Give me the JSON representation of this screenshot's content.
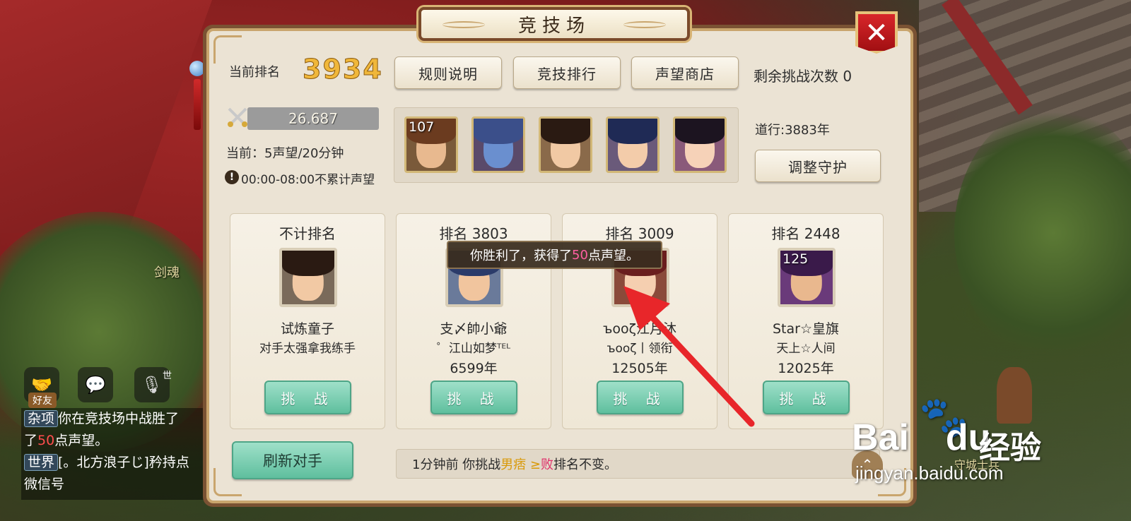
{
  "background": {
    "labels": {
      "sword_soul": "剑魂",
      "guard": "守城士兵"
    },
    "side_buttons": {
      "friends_label": "好友",
      "voice_tag": "世"
    },
    "chat": {
      "line1_tag": "杂项",
      "line1_text": "你在竞技场中战胜了",
      "line2_prefix": "了",
      "line2_highlight": "50",
      "line2_suffix": "点声望。",
      "line3_tag": "世界",
      "line3_text": "[。北方浪子じ]矜持点",
      "line4_text": "微信号"
    }
  },
  "panel": {
    "title": "竞技场",
    "close_label": "✕",
    "current_rank_label": "当前排名",
    "current_rank_value": "3934",
    "buttons": {
      "rules": "规则说明",
      "leaderboard": "竞技排行",
      "shop": "声望商店",
      "adjust_guard": "调整守护",
      "refresh": "刷新对手"
    },
    "remaining_challenges": "剩余挑战次数 0",
    "reputation_value": "26.687",
    "reputation_fill": 0.0,
    "rate_text": "当前：5声望/20分钟",
    "warning_text": "00:00-08:00不累计声望",
    "cultivation_text": "道行:3883年",
    "guards": [
      {
        "level": "107",
        "skin": "#e8b98f",
        "hair": "#6b3b1f",
        "bg": "#7a5a3a"
      },
      {
        "level": "",
        "skin": "#6a8fcf",
        "hair": "#3b4f8a",
        "bg": "#5a4a6a"
      },
      {
        "level": "",
        "skin": "#f1c9a4",
        "hair": "#2a1a12",
        "bg": "#8a6a4a"
      },
      {
        "level": "",
        "skin": "#f3ccaa",
        "hair": "#1f2a55",
        "bg": "#6a5a7a"
      },
      {
        "level": "",
        "skin": "#f6d2b8",
        "hair": "#1c1420",
        "bg": "#8a5a7a"
      }
    ],
    "opponents": [
      {
        "rank_label": "不计排名",
        "level": "",
        "name": "试炼童子",
        "line2": "对手太强拿我练手",
        "line3": "",
        "challenge": "挑 战",
        "skin": "#f2c9a4",
        "hair": "#2a1a12",
        "bg": "#7a6a5a"
      },
      {
        "rank_label": "排名 3803",
        "level": "",
        "name": "支〆帥小爺",
        "line2": "゜江山如梦ᵀᴱᴸ",
        "line3": "6599年",
        "challenge": "挑 战",
        "skin": "#f1c59e",
        "hair": "#2b3b6a",
        "bg": "#6a7a9a"
      },
      {
        "rank_label": "排名 3009",
        "level": "",
        "name": "ъooζ江月沐",
        "line2": "ъooζ丨领衔",
        "line3": "12505年",
        "challenge": "挑 战",
        "skin": "#f5cfb0",
        "hair": "#6a1e1e",
        "bg": "#8a4a3a"
      },
      {
        "rank_label": "排名 2448",
        "level": "125",
        "name": "Star☆皇旗",
        "line2": "天上☆人间",
        "line3": "12025年",
        "challenge": "挑 战",
        "skin": "#e9b88e",
        "hair": "#3a1a4a",
        "bg": "#6a3a7a"
      }
    ],
    "tooltip": {
      "prefix": "你胜利了，获得了",
      "highlight": "50",
      "suffix": "点声望。"
    },
    "log": {
      "prefix": "1分钟前 你挑战",
      "name": "男痞 ≥ ",
      "result": "败",
      "suffix": " 排名不变。"
    }
  },
  "watermark": {
    "brand": "Bai",
    "brand2": "du",
    "exp": "经验",
    "url": "jingyan.baidu.com"
  },
  "colors": {
    "accent_gold": "#f0b73a",
    "challenge_green": "#5fbf9e",
    "close_red": "#c0171b",
    "highlight_pink": "#ff5fa2"
  }
}
